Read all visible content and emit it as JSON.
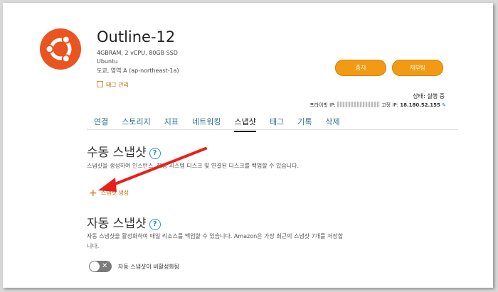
{
  "instance": {
    "name": "Outline-12",
    "specs": "4GBRAM, 2 vCPU, 80GB SSD",
    "os": "Ubuntu",
    "zone": "도쿄, 영역 A (ap-northeast-1a)",
    "manage_tags": "태그 관리"
  },
  "actions": {
    "stop": "중지",
    "reboot": "재부팅"
  },
  "status": {
    "text": "상태: 실행 중",
    "private_ip_label": "프라이빗 IP:",
    "public_ip_label": "고정 IP:",
    "public_ip": "18.180.52.155"
  },
  "tabs": [
    "연결",
    "스토리지",
    "지표",
    "네트워킹",
    "스냅샷",
    "태그",
    "기록",
    "삭제"
  ],
  "active_tab": "스냅샷",
  "manual": {
    "heading": "수동 스냅샷",
    "description": "스냅샷을 생성하여 인스턴스, 해당 시스템 디스크 및 연결된 디스크를 백업할 수 있습니다.",
    "create_label": "스냅샷 생성"
  },
  "auto": {
    "heading": "자동 스냅샷",
    "description": "자동 스냅샷을 활성화하여 매일 리소스를 백업할 수 있습니다. Amazon은 가장 최근의 스냅샷 7개를 저장합니다.",
    "toggle_label": "자동 스냅샷이 비활성화됨",
    "enabled": false
  },
  "colors": {
    "brand": "#e95420",
    "accent": "#f29a13",
    "link": "#2b6f8f",
    "arrow": "#e8201a"
  }
}
